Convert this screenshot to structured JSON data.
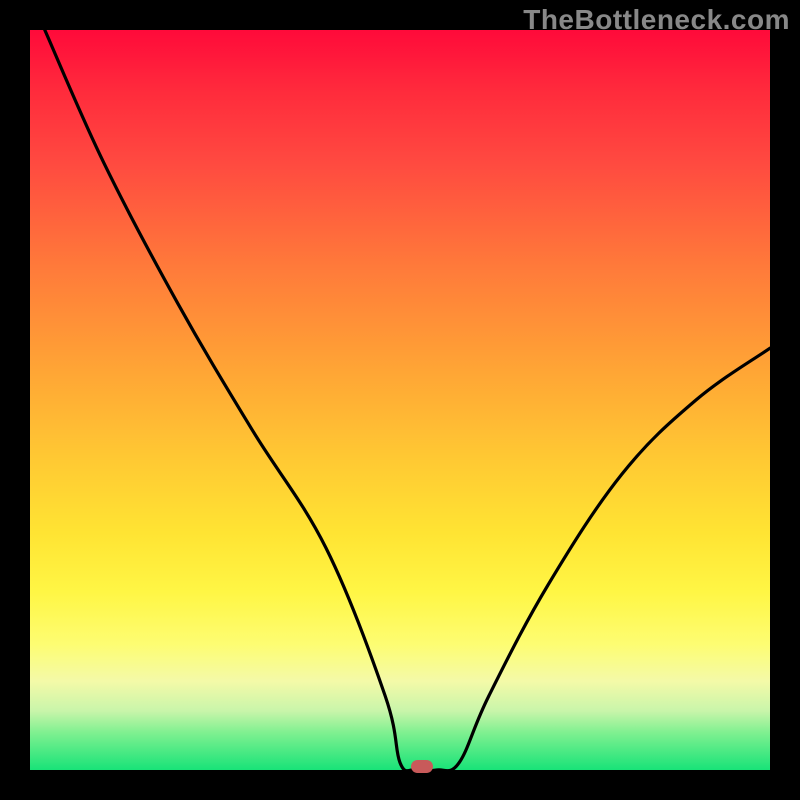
{
  "watermark": "TheBottleneck.com",
  "colors": {
    "frame_bg": "#000000",
    "gradient_top": "#ff0a3a",
    "gradient_mid": "#ffe433",
    "gradient_bottom": "#18e378",
    "curve_stroke": "#000000",
    "marker_fill": "#c85a5a"
  },
  "chart_data": {
    "type": "line",
    "title": "",
    "xlabel": "",
    "ylabel": "",
    "xlim": [
      0,
      100
    ],
    "ylim": [
      0,
      100
    ],
    "legend": false,
    "grid": false,
    "series": [
      {
        "name": "curve",
        "x": [
          2,
          10,
          20,
          30,
          40,
          48,
          50,
          52,
          55,
          58,
          62,
          70,
          80,
          90,
          100
        ],
        "y": [
          100,
          82,
          63,
          46,
          30,
          10,
          1,
          0,
          0,
          1,
          10,
          25,
          40,
          50,
          57
        ]
      }
    ],
    "marker": {
      "x": 53,
      "y": 0
    }
  }
}
